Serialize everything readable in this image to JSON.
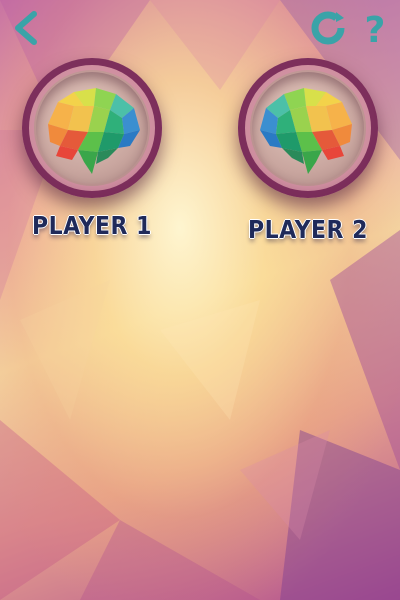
{
  "screen": {
    "colors": {
      "accent": "#3aa3a8",
      "label": "#1f2a5a"
    }
  },
  "toolbar": {
    "back_icon": "chevron-left-icon",
    "restart_icon": "restart-icon",
    "help_icon": "question-mark-icon",
    "help_glyph": "?"
  },
  "players": [
    {
      "label": "PLAYER 1",
      "icon": "brain-icon"
    },
    {
      "label": "PLAYER 2",
      "icon": "brain-icon"
    }
  ]
}
